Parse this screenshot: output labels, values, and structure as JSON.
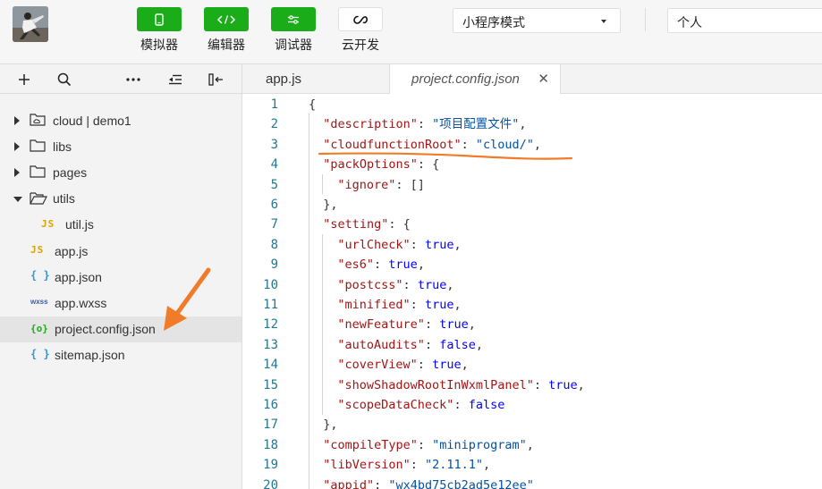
{
  "toolbar": {
    "buttons": [
      {
        "label": "模拟器",
        "icon": "phone-icon"
      },
      {
        "label": "编辑器",
        "icon": "code-brackets-icon"
      },
      {
        "label": "调试器",
        "icon": "sliders-icon"
      },
      {
        "label": "云开发",
        "icon": "cloud-icon"
      }
    ],
    "mode_select": "小程序模式",
    "account_select": "个人",
    "accent_color": "#1aad19"
  },
  "sidebar": {
    "tools": [
      "plus-icon",
      "search-icon",
      "more-icon",
      "collapse-list-icon",
      "split-panel-icon"
    ],
    "tree": [
      {
        "name": "cloud | demo1",
        "type": "cloud-folder"
      },
      {
        "name": "libs",
        "type": "folder"
      },
      {
        "name": "pages",
        "type": "folder"
      },
      {
        "name": "utils",
        "type": "folder-open"
      },
      {
        "name": "util.js",
        "type": "js"
      },
      {
        "name": "app.js",
        "type": "js"
      },
      {
        "name": "app.json",
        "type": "json"
      },
      {
        "name": "app.wxss",
        "type": "wxss"
      },
      {
        "name": "project.config.json",
        "type": "config",
        "selected": true
      },
      {
        "name": "sitemap.json",
        "type": "json"
      }
    ],
    "icon_glyphs": {
      "js": "JS",
      "json": "{ }",
      "wxss": "wxss",
      "config": "{o}"
    }
  },
  "tabs": [
    {
      "label": "app.js",
      "active": false
    },
    {
      "label": "project.config.json",
      "active": true,
      "close": "✕"
    }
  ],
  "editor": {
    "line_numbers": [
      "1",
      "2",
      "3",
      "4",
      "5",
      "6",
      "7",
      "8",
      "9",
      "10",
      "11",
      "12",
      "13",
      "14",
      "15",
      "16",
      "17",
      "18",
      "19",
      "20"
    ],
    "lines": [
      {
        "indent": 0,
        "tokens": [
          {
            "t": "{",
            "c": "p"
          }
        ]
      },
      {
        "indent": 1,
        "tokens": [
          {
            "t": "\"description\"",
            "c": "k"
          },
          {
            "t": ": ",
            "c": "p"
          },
          {
            "t": "\"项目配置文件\"",
            "c": "s"
          },
          {
            "t": ",",
            "c": "p"
          }
        ]
      },
      {
        "indent": 1,
        "tokens": [
          {
            "t": "\"cloudfunctionRoot\"",
            "c": "k"
          },
          {
            "t": ": ",
            "c": "p"
          },
          {
            "t": "\"cloud/\"",
            "c": "s"
          },
          {
            "t": ",",
            "c": "p"
          }
        ]
      },
      {
        "indent": 1,
        "tokens": [
          {
            "t": "\"packOptions\"",
            "c": "k"
          },
          {
            "t": ": {",
            "c": "p"
          }
        ]
      },
      {
        "indent": 2,
        "tokens": [
          {
            "t": "\"ignore\"",
            "c": "k"
          },
          {
            "t": ": []",
            "c": "p"
          }
        ]
      },
      {
        "indent": 1,
        "tokens": [
          {
            "t": "},",
            "c": "p"
          }
        ]
      },
      {
        "indent": 1,
        "tokens": [
          {
            "t": "\"setting\"",
            "c": "k"
          },
          {
            "t": ": {",
            "c": "p"
          }
        ]
      },
      {
        "indent": 2,
        "tokens": [
          {
            "t": "\"urlCheck\"",
            "c": "k"
          },
          {
            "t": ": ",
            "c": "p"
          },
          {
            "t": "true",
            "c": "b"
          },
          {
            "t": ",",
            "c": "p"
          }
        ]
      },
      {
        "indent": 2,
        "tokens": [
          {
            "t": "\"es6\"",
            "c": "k"
          },
          {
            "t": ": ",
            "c": "p"
          },
          {
            "t": "true",
            "c": "b"
          },
          {
            "t": ",",
            "c": "p"
          }
        ]
      },
      {
        "indent": 2,
        "tokens": [
          {
            "t": "\"postcss\"",
            "c": "k"
          },
          {
            "t": ": ",
            "c": "p"
          },
          {
            "t": "true",
            "c": "b"
          },
          {
            "t": ",",
            "c": "p"
          }
        ]
      },
      {
        "indent": 2,
        "tokens": [
          {
            "t": "\"minified\"",
            "c": "k"
          },
          {
            "t": ": ",
            "c": "p"
          },
          {
            "t": "true",
            "c": "b"
          },
          {
            "t": ",",
            "c": "p"
          }
        ]
      },
      {
        "indent": 2,
        "tokens": [
          {
            "t": "\"newFeature\"",
            "c": "k"
          },
          {
            "t": ": ",
            "c": "p"
          },
          {
            "t": "true",
            "c": "b"
          },
          {
            "t": ",",
            "c": "p"
          }
        ]
      },
      {
        "indent": 2,
        "tokens": [
          {
            "t": "\"autoAudits\"",
            "c": "k"
          },
          {
            "t": ": ",
            "c": "p"
          },
          {
            "t": "false",
            "c": "b"
          },
          {
            "t": ",",
            "c": "p"
          }
        ]
      },
      {
        "indent": 2,
        "tokens": [
          {
            "t": "\"coverView\"",
            "c": "k"
          },
          {
            "t": ": ",
            "c": "p"
          },
          {
            "t": "true",
            "c": "b"
          },
          {
            "t": ",",
            "c": "p"
          }
        ]
      },
      {
        "indent": 2,
        "tokens": [
          {
            "t": "\"showShadowRootInWxmlPanel\"",
            "c": "k"
          },
          {
            "t": ": ",
            "c": "p"
          },
          {
            "t": "true",
            "c": "b"
          },
          {
            "t": ",",
            "c": "p"
          }
        ]
      },
      {
        "indent": 2,
        "tokens": [
          {
            "t": "\"scopeDataCheck\"",
            "c": "k"
          },
          {
            "t": ": ",
            "c": "p"
          },
          {
            "t": "false",
            "c": "b"
          }
        ]
      },
      {
        "indent": 1,
        "tokens": [
          {
            "t": "},",
            "c": "p"
          }
        ]
      },
      {
        "indent": 1,
        "tokens": [
          {
            "t": "\"compileType\"",
            "c": "k"
          },
          {
            "t": ": ",
            "c": "p"
          },
          {
            "t": "\"miniprogram\"",
            "c": "s"
          },
          {
            "t": ",",
            "c": "p"
          }
        ]
      },
      {
        "indent": 1,
        "tokens": [
          {
            "t": "\"libVersion\"",
            "c": "k"
          },
          {
            "t": ": ",
            "c": "p"
          },
          {
            "t": "\"2.11.1\"",
            "c": "s"
          },
          {
            "t": ",",
            "c": "p"
          }
        ]
      },
      {
        "indent": 1,
        "tokens": [
          {
            "t": "\"appid\"",
            "c": "k"
          },
          {
            "t": ": ",
            "c": "p"
          },
          {
            "t": "\"wx4bd75cb2ad5e12ee\"",
            "c": "s"
          }
        ]
      }
    ]
  },
  "annotations": {
    "color": "#f07c2a"
  }
}
